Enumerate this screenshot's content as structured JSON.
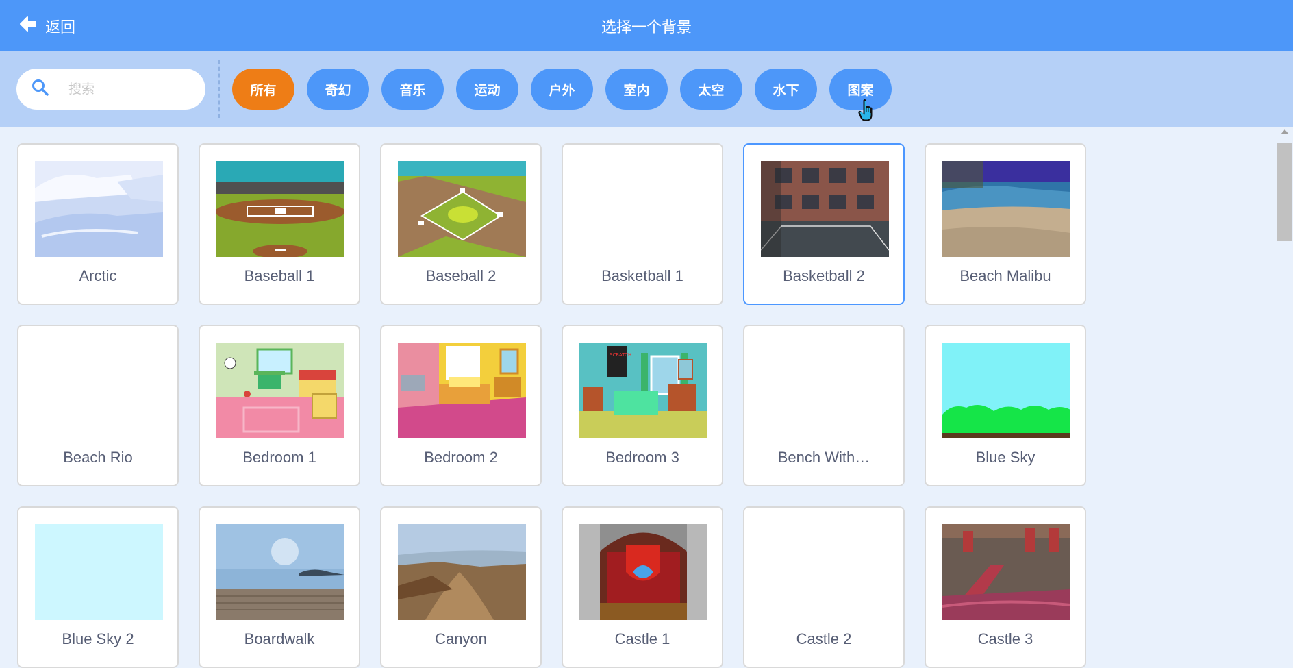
{
  "header": {
    "back_label": "返回",
    "title": "选择一个背景"
  },
  "search": {
    "placeholder": "搜索",
    "value": ""
  },
  "tags": [
    "所有",
    "奇幻",
    "音乐",
    "运动",
    "户外",
    "室内",
    "太空",
    "水下",
    "图案"
  ],
  "active_tag_index": 0,
  "colors": {
    "header": "#4d97f9",
    "filter_bar": "#b5d0f7",
    "active_tag": "#ee7d16",
    "background": "#e9f1fc"
  },
  "backdrops": [
    {
      "name": "Arctic",
      "thumb": "arctic"
    },
    {
      "name": "Baseball 1",
      "thumb": "baseball1"
    },
    {
      "name": "Baseball 2",
      "thumb": "baseball2"
    },
    {
      "name": "Basketball 1",
      "thumb": "blank"
    },
    {
      "name": "Basketball 2",
      "thumb": "basketball2",
      "selected": true
    },
    {
      "name": "Beach Malibu",
      "thumb": "beach-malibu"
    },
    {
      "name": "Beach Rio",
      "thumb": "blank"
    },
    {
      "name": "Bedroom 1",
      "thumb": "bedroom1"
    },
    {
      "name": "Bedroom 2",
      "thumb": "bedroom2"
    },
    {
      "name": "Bedroom 3",
      "thumb": "bedroom3"
    },
    {
      "name": "Bench With…",
      "thumb": "blank"
    },
    {
      "name": "Blue Sky",
      "thumb": "blue-sky"
    },
    {
      "name": "Blue Sky 2",
      "thumb": "blue-sky2"
    },
    {
      "name": "Boardwalk",
      "thumb": "boardwalk"
    },
    {
      "name": "Canyon",
      "thumb": "canyon"
    },
    {
      "name": "Castle 1",
      "thumb": "castle1"
    },
    {
      "name": "Castle 2",
      "thumb": "blank"
    },
    {
      "name": "Castle 3",
      "thumb": "castle3"
    }
  ]
}
